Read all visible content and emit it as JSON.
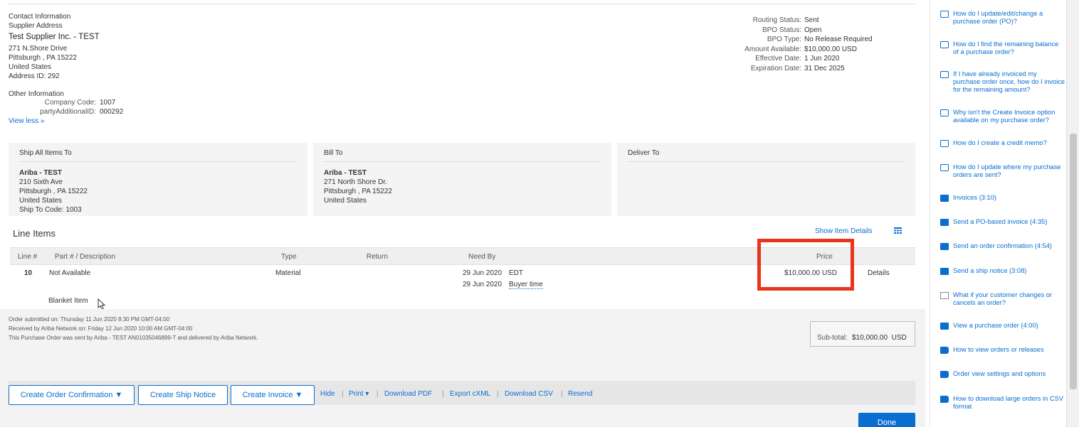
{
  "contact": {
    "section_title": "Contact Information",
    "supplier_label": "Supplier Address",
    "supplier_name": "Test Supplier Inc. - TEST",
    "address_line1": "271 N.Shore Drive",
    "address_line2": "Pittsburgh , PA 15222",
    "address_line3": "United States",
    "address_id": "Address ID:  292"
  },
  "other_info": {
    "title": "Other Information",
    "company_code_label": "Company Code:",
    "company_code_value": "1007",
    "party_label": "partyAdditionalID:",
    "party_value": "000292",
    "view_less": "View less »"
  },
  "status": {
    "routing_label": "Routing Status:",
    "routing_value": "Sent",
    "bpo_status_label": "BPO Status:",
    "bpo_status_value": "Open",
    "bpo_type_label": "BPO Type:",
    "bpo_type_value": "No Release Required",
    "amount_label": "Amount Available:",
    "amount_value": "$10,000.00 USD",
    "effective_label": "Effective Date:",
    "effective_value": "1 Jun 2020",
    "expiration_label": "Expiration Date:",
    "expiration_value": "31 Dec 2025"
  },
  "ship_to": {
    "title": "Ship All Items To",
    "name": "Ariba - TEST",
    "line1": "210 Sixth Ave",
    "line2": "Pittsburgh , PA 15222",
    "line3": "United States",
    "line4": "Ship To Code:  1003"
  },
  "bill_to": {
    "title": "Bill To",
    "name": "Ariba - TEST",
    "line1": "271 North Shore Dr.",
    "line2": "Pittsburgh , PA 15222",
    "line3": "United States"
  },
  "deliver_to": {
    "title": "Deliver To"
  },
  "line_items": {
    "title": "Line Items",
    "show_details": "Show Item Details",
    "columns": {
      "line": "Line #",
      "part": "Part # / Description",
      "type": "Type",
      "return": "Return",
      "need_by": "Need By",
      "price": "Price"
    },
    "row": {
      "line": "10",
      "part": "Not Available",
      "type": "Material",
      "date1": "29 Jun 2020",
      "tz1": "EDT",
      "date2": "29 Jun 2020",
      "tz2": "Buyer time",
      "price": "$10,000.00 USD",
      "details": "Details",
      "sub": "Blanket Item"
    }
  },
  "order_notes": {
    "submitted": "Order submitted on: Thursday 11 Jun 2020 8:30 PM GMT-04:00",
    "received": "Received by Ariba Network on: Friday 12 Jun 2020 10:00 AM GMT-04:00",
    "sent": "This Purchase Order was sent by Ariba - TEST AN01035046899-T and delivered by Ariba Network."
  },
  "subtotal": {
    "label": "Sub-total:",
    "value": "$10,000.00  USD"
  },
  "actions": {
    "create_confirmation": "Create Order Confirmation ▼",
    "create_ship_notice": "Create Ship Notice",
    "create_invoice": "Create Invoice ▼",
    "hide": "Hide",
    "print": "Print ▾",
    "download_pdf": "Download PDF",
    "export_cxml": "Export cXML",
    "download_csv": "Download CSV",
    "resend": "Resend",
    "done": "Done"
  },
  "sidebar": {
    "items": [
      {
        "icon": "faq-icon",
        "label": "How do I update/edit/change a purchase order (PO)?"
      },
      {
        "icon": "faq-icon",
        "label": "How do I find the remaining balance of a purchase order?"
      },
      {
        "icon": "faq-icon",
        "label": "If I have already invoiced my purchase order once, how do I invoice for the remaining amount?"
      },
      {
        "icon": "faq-icon",
        "label": "Why isn't the Create Invoice option available on my purchase order?"
      },
      {
        "icon": "faq-icon",
        "label": "How do I create a credit memo?"
      },
      {
        "icon": "faq-icon",
        "label": "How do I update where my purchase orders are sent?"
      },
      {
        "icon": "video-icon",
        "label": "Invoices (3:10)"
      },
      {
        "icon": "video-icon",
        "label": "Send a PO-based invoice (4:35)"
      },
      {
        "icon": "video-icon",
        "label": "Send an order confirmation (4:54)"
      },
      {
        "icon": "video-icon",
        "label": "Send a ship notice (3:08)"
      },
      {
        "icon": "document-icon",
        "label": "What if your customer changes or cancels an order?"
      },
      {
        "icon": "video-icon",
        "label": "View a purchase order (4:00)"
      },
      {
        "icon": "book-icon",
        "label": "How to view orders or releases"
      },
      {
        "icon": "book-icon",
        "label": "Order view settings and options"
      },
      {
        "icon": "book-icon",
        "label": "How to download large orders in CSV format"
      }
    ]
  },
  "colors": {
    "link": "#0a6ed1",
    "highlight": "#e8361c"
  }
}
